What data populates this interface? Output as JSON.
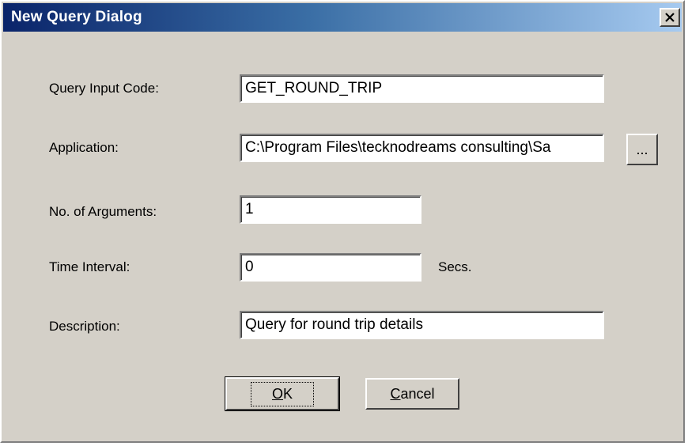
{
  "window": {
    "title": "New Query Dialog",
    "close_glyph": "✕"
  },
  "form": {
    "query_input_code": {
      "label": "Query Input Code:",
      "value": "GET_ROUND_TRIP"
    },
    "application": {
      "label": "Application:",
      "value": "C:\\Program Files\\tecknodreams consulting\\Sa",
      "browse_label": "..."
    },
    "num_arguments": {
      "label": "No. of Arguments:",
      "value": "1"
    },
    "time_interval": {
      "label": "Time Interval:",
      "value": "0",
      "unit": "Secs."
    },
    "description": {
      "label": "Description:",
      "value": "Query for round trip details"
    }
  },
  "buttons": {
    "ok_mnemonic": "O",
    "ok_rest": "K",
    "cancel_mnemonic": "C",
    "cancel_rest": "ancel"
  },
  "icons": {
    "close": "close-icon"
  },
  "colors": {
    "title_start": "#0a246a",
    "title_end": "#a6caf0",
    "face": "#d4d0c8"
  }
}
